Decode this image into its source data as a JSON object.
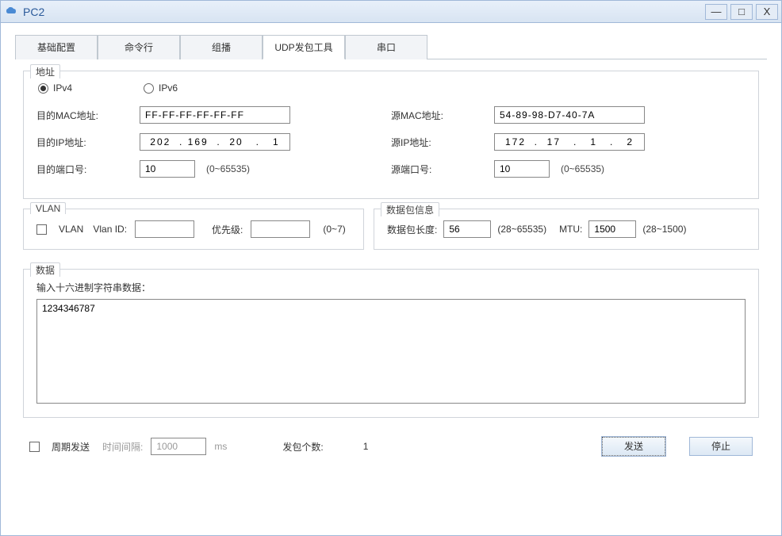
{
  "window": {
    "title": "PC2"
  },
  "tabs": [
    "基础配置",
    "命令行",
    "组播",
    "UDP发包工具",
    "串口"
  ],
  "active_tab": 3,
  "address": {
    "legend": "地址",
    "ipv4_label": "IPv4",
    "ipv6_label": "IPv6",
    "ip_version": "IPv4",
    "dest_mac_label": "目的MAC地址:",
    "dest_mac": "FF-FF-FF-FF-FF-FF",
    "src_mac_label": "源MAC地址:",
    "src_mac": "54-89-98-D7-40-7A",
    "dest_ip_label": "目的IP地址:",
    "dest_ip": "202  . 169  .  20   .   1",
    "src_ip_label": "源IP地址:",
    "src_ip": "172  .  17   .   1   .   2",
    "dest_port_label": "目的端口号:",
    "dest_port": "10",
    "src_port_label": "源端口号:",
    "src_port": "10",
    "port_hint": "(0~65535)"
  },
  "vlan": {
    "legend": "VLAN",
    "checkbox_label": "VLAN",
    "vlan_id_label": "Vlan ID:",
    "vlan_id": "",
    "priority_label": "优先级:",
    "priority": "",
    "priority_hint": "(0~7)"
  },
  "packet": {
    "legend": "数据包信息",
    "length_label": "数据包长度:",
    "length": "56",
    "length_hint": "(28~65535)",
    "mtu_label": "MTU:",
    "mtu": "1500",
    "mtu_hint": "(28~1500)"
  },
  "data": {
    "legend": "数据",
    "input_label": "输入十六进制字符串数据：",
    "value": "1234346787"
  },
  "bottom": {
    "periodic_label": "周期发送",
    "interval_label": "时间间隔:",
    "interval": "1000",
    "interval_unit": "ms",
    "count_label": "发包个数:",
    "count": "1",
    "send_btn": "发送",
    "stop_btn": "停止"
  }
}
